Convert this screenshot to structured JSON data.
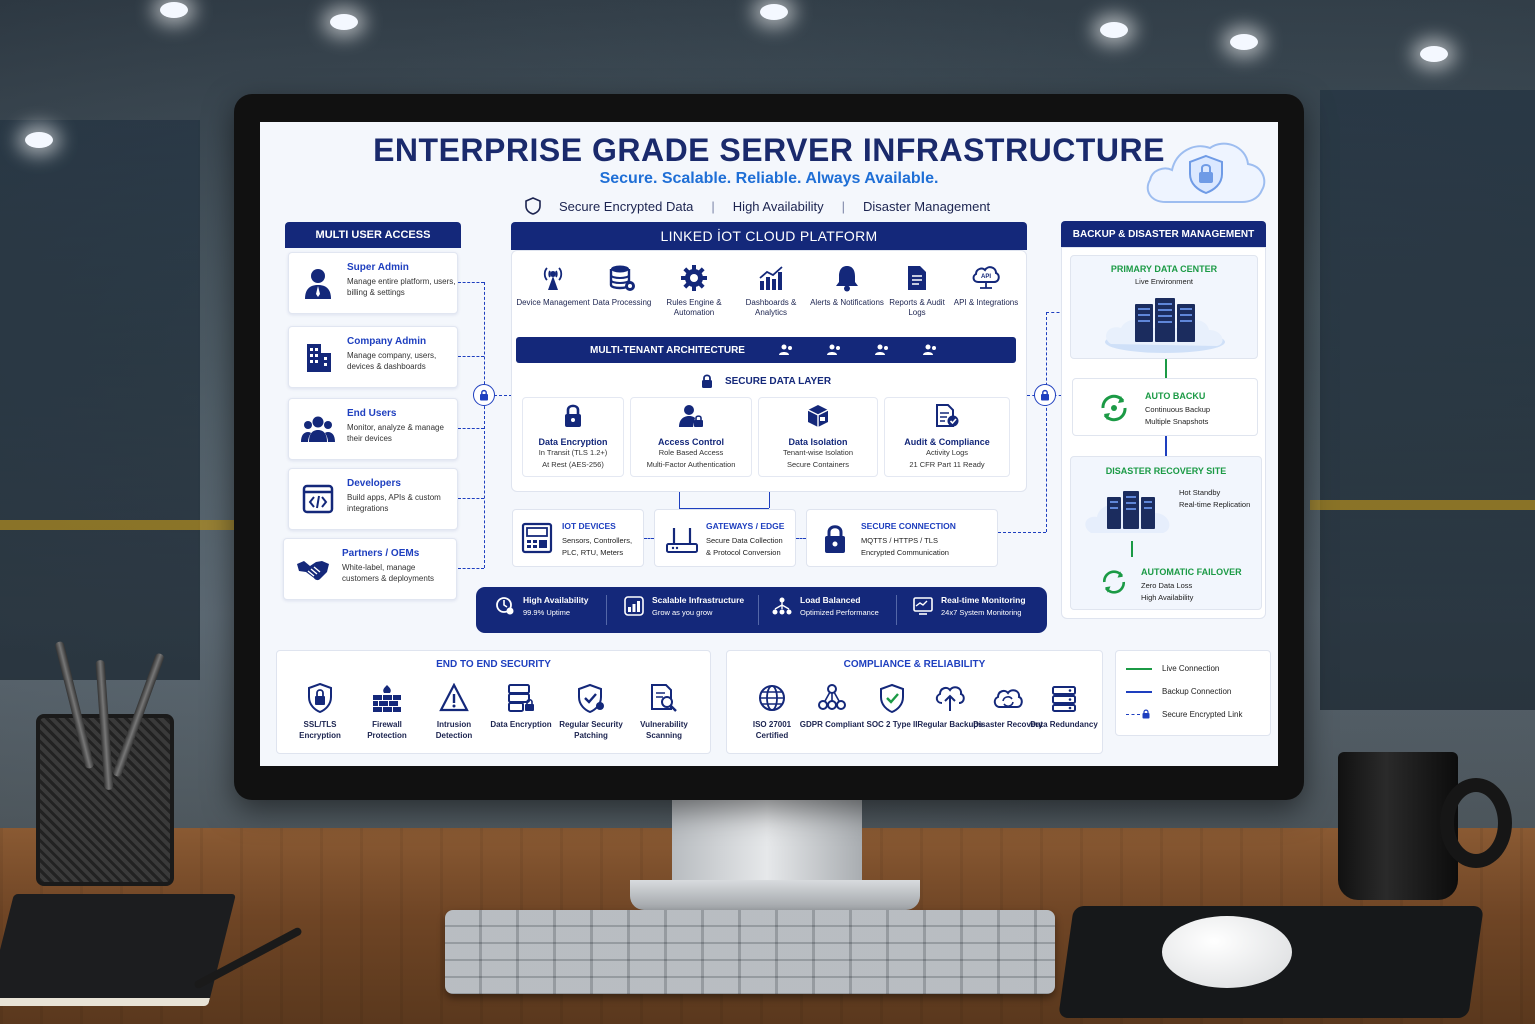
{
  "page": {
    "title": "ENTERPRISE GRADE SERVER INFRASTRUCTURE",
    "subtitle": "Secure. Scalable. Reliable. Always Available.",
    "features": [
      "Secure Encrypted Data",
      "High Availability",
      "Disaster Management"
    ],
    "separator": "|"
  },
  "multi_user": {
    "header": "MULTI USER ACCESS",
    "users": [
      {
        "name": "Super Admin",
        "desc": "Manage entire platform, users, billing & settings",
        "icon": "user-tie-icon"
      },
      {
        "name": "Company Admin",
        "desc": "Manage company, users, devices & dashboards",
        "icon": "building-icon"
      },
      {
        "name": "End Users",
        "desc": "Monitor, analyze & manage their devices",
        "icon": "users-icon"
      },
      {
        "name": "Developers",
        "desc": "Build apps, APIs & custom integrations",
        "icon": "code-icon"
      },
      {
        "name": "Partners / OEMs",
        "desc": "White-label, manage customers & deployments",
        "icon": "handshake-icon"
      }
    ]
  },
  "platform": {
    "header": "LINKED İOT CLOUD PLATFORM",
    "modules": [
      {
        "label": "Device Management",
        "icon": "antenna-icon"
      },
      {
        "label": "Data Processing",
        "icon": "database-icon"
      },
      {
        "label": "Rules Engine & Automation",
        "icon": "gear-icon"
      },
      {
        "label": "Dashboards & Analytics",
        "icon": "bar-chart-icon"
      },
      {
        "label": "Alerts & Notifications",
        "icon": "bell-icon"
      },
      {
        "label": "Reports & Audit Logs",
        "icon": "document-icon"
      },
      {
        "label": "API & Integrations",
        "icon": "api-cloud-icon"
      }
    ],
    "multi_tenant": "MULTI-TENANT ARCHITECTURE",
    "secure_layer": "SECURE DATA LAYER",
    "security_cards": [
      {
        "title": "Data Encryption",
        "lines": [
          "In Transit (TLS 1.2+)",
          "At Rest (AES-256)"
        ],
        "icon": "lock-icon"
      },
      {
        "title": "Access Control",
        "lines": [
          "Role Based Access",
          "Multi-Factor Authentication"
        ],
        "icon": "user-lock-icon"
      },
      {
        "title": "Data Isolation",
        "lines": [
          "Tenant-wise Isolation",
          "Secure Containers"
        ],
        "icon": "cube-icon"
      },
      {
        "title": "Audit & Compliance",
        "lines": [
          "Activity Logs",
          "21 CFR Part 11 Ready"
        ],
        "icon": "audit-doc-icon"
      }
    ]
  },
  "devices": [
    {
      "title": "IOT DEVICES",
      "lines": [
        "Sensors, Controllers,",
        "PLC, RTU, Meters"
      ],
      "icon": "control-panel-icon"
    },
    {
      "title": "GATEWAYS / EDGE",
      "lines": [
        "Secure Data Collection",
        "& Protocol Conversion"
      ],
      "icon": "router-icon"
    },
    {
      "title": "SECURE CONNECTION",
      "lines": [
        "MQTTS / HTTPS / TLS",
        "Encrypted Communication"
      ],
      "icon": "padlock-icon"
    }
  ],
  "stats": [
    {
      "title": "High Availability",
      "desc": "99.9% Uptime",
      "icon": "uptime-icon"
    },
    {
      "title": "Scalable Infrastructure",
      "desc": "Grow as you grow",
      "icon": "scale-icon"
    },
    {
      "title": "Load Balanced",
      "desc": "Optimized Performance",
      "icon": "network-icon"
    },
    {
      "title": "Real-time Monitoring",
      "desc": "24x7 System Monitoring",
      "icon": "monitor-icon"
    }
  ],
  "backup": {
    "header": "BACKUP & DISASTER MANAGEMENT",
    "primary": {
      "title": "PRIMARY DATA CENTER",
      "desc": "Live Environment"
    },
    "auto_backup": {
      "title": "AUTO BACKU",
      "lines": [
        "Continuous Backup",
        "Multiple Snapshots"
      ]
    },
    "dr_site": {
      "title": "DISASTER RECOVERY SITE",
      "lines": [
        "Hot Standby",
        "Real-time Replication"
      ]
    },
    "failover": {
      "title": "AUTOMATIC FAILOVER",
      "lines": [
        "Zero Data Loss",
        "High Availability"
      ]
    }
  },
  "end_security": {
    "title": "END TO END SECURITY",
    "items": [
      {
        "label": "SSL/TLS Encryption",
        "icon": "ssl-lock-icon"
      },
      {
        "label": "Firewall Protection",
        "icon": "firewall-icon"
      },
      {
        "label": "Intrusion Detection",
        "icon": "alert-triangle-icon"
      },
      {
        "label": "Data Encryption",
        "icon": "server-lock-icon"
      },
      {
        "label": "Regular Security Patching",
        "icon": "shield-check-icon"
      },
      {
        "label": "Vulnerability Scanning",
        "icon": "scan-doc-icon"
      }
    ]
  },
  "compliance": {
    "title": "COMPLIANCE & RELIABILITY",
    "items": [
      {
        "label": "ISO 27001 Certified",
        "icon": "globe-icon"
      },
      {
        "label": "GDPR Compliant",
        "icon": "gdpr-network-icon"
      },
      {
        "label": "SOC 2 Type II",
        "icon": "shield-tick-icon"
      },
      {
        "label": "Regular Backups",
        "icon": "cloud-upload-icon"
      },
      {
        "label": "Disaster Recovery",
        "icon": "cloud-sync-icon"
      },
      {
        "label": "Data Redundancy",
        "icon": "storage-icon"
      }
    ]
  },
  "legend": [
    {
      "label": "Live Connection",
      "color": "#1b9a45",
      "style": "solid"
    },
    {
      "label": "Backup Connection",
      "color": "#1e3fbf",
      "style": "solid"
    },
    {
      "label": "Secure Encrypted Link",
      "color": "#1e3fbf",
      "style": "dashed"
    }
  ],
  "colors": {
    "navy": "#14287a",
    "blue": "#1e3fbf",
    "green": "#1b9a45",
    "accent": "#1f6fd6"
  }
}
